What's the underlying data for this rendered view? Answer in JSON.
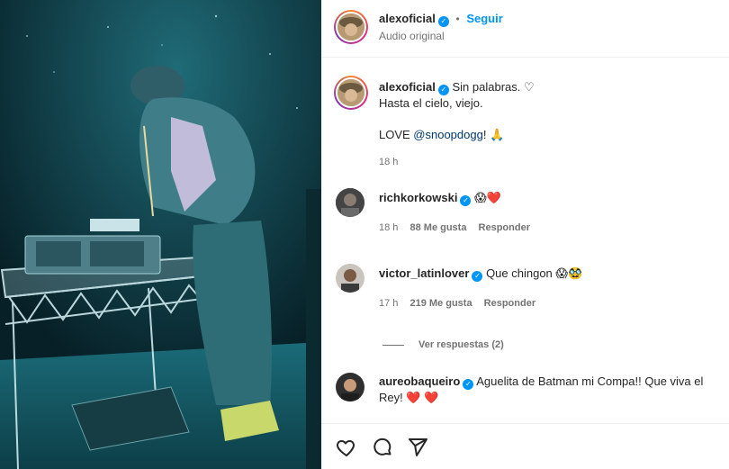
{
  "header": {
    "username": "alexoficial",
    "dot": "•",
    "follow_label": "Seguir",
    "subtitle": "Audio original"
  },
  "caption": {
    "username": "alexoficial",
    "line1": "Sin palabras. ♡",
    "line2": "Hasta el cielo, viejo.",
    "line3_prefix": "LOVE ",
    "mention": "@snoopdogg",
    "line3_suffix": "! 🙏",
    "time": "18 h"
  },
  "comments": [
    {
      "username": "richkorkowski",
      "text": "😱❤️",
      "time": "18 h",
      "likes": "88 Me gusta",
      "reply": "Responder"
    },
    {
      "username": "victor_latinlover",
      "text": "Que chingon 😱🥸",
      "time": "17 h",
      "likes": "219 Me gusta",
      "reply": "Responder",
      "view_replies": "Ver respuestas (2)"
    },
    {
      "username": "aureobaqueiro",
      "text": "Aguelita de Batman mi Compa!! Que viva el",
      "text2": "Rey! ❤️ ❤️"
    }
  ],
  "icons": {
    "like": "heart-icon",
    "comment": "comment-icon",
    "share": "share-icon",
    "verified": "verified-badge-icon"
  },
  "colors": {
    "accent": "#0095f6",
    "text": "#262626",
    "muted": "#737373",
    "heart": "#ed1c24"
  }
}
